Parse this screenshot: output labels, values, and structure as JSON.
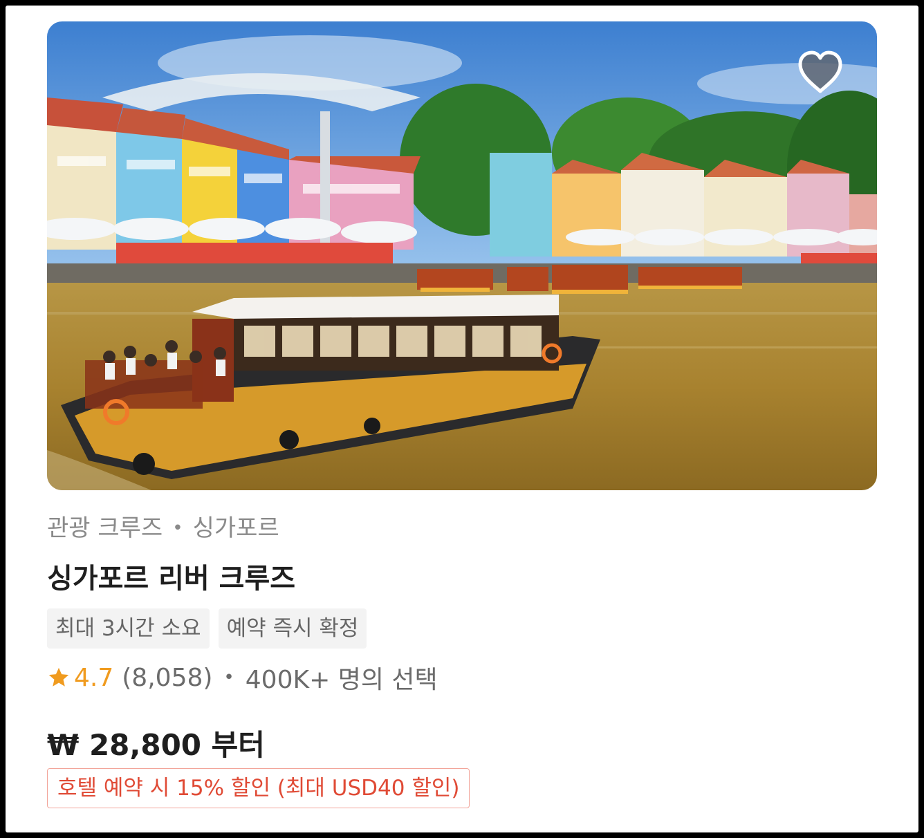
{
  "image": {
    "description_icon": "river-cruise-photo"
  },
  "favorite": {
    "icon": "heart-icon",
    "fill": "#5f6672",
    "stroke": "#ffffff"
  },
  "meta": {
    "category": "관광 크루즈",
    "separator": "•",
    "location": "싱가포르"
  },
  "title": "싱가포르 리버 크루즈",
  "tags": [
    {
      "label": "최대 3시간 소요"
    },
    {
      "label": "예약 즉시 확정"
    }
  ],
  "rating": {
    "star_icon": "star-icon",
    "score": "4.7",
    "count": "(8,058)",
    "separator": "•",
    "popularity": "400K+ 명의 선택"
  },
  "price": {
    "text": "₩ 28,800 부터"
  },
  "promo": {
    "text": "호텔 예약 시 15% 할인 (최대 USD40 할인)"
  },
  "colors": {
    "accent_star": "#f09b1f",
    "promo_red": "#e04a35",
    "promo_border": "#f2a59a"
  }
}
